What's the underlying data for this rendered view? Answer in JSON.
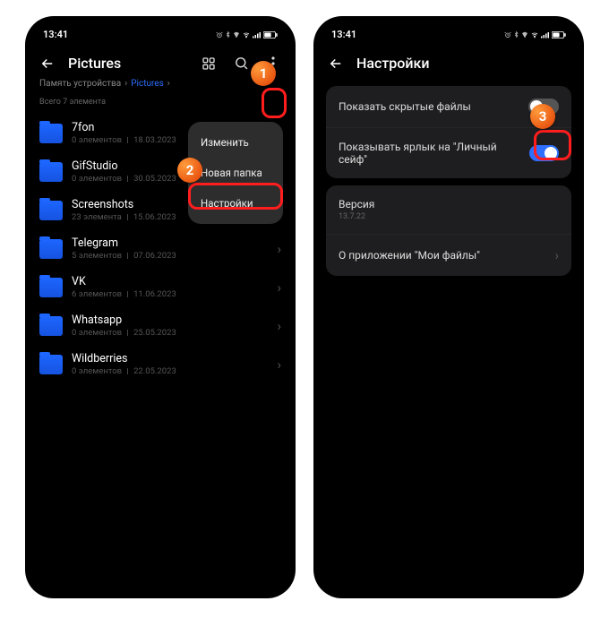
{
  "status": {
    "time": "13:41",
    "indicators": "⋯"
  },
  "left": {
    "title": "Pictures",
    "breadcrumb": {
      "root": "Память устройства",
      "active": "Pictures"
    },
    "count_label": "Всего 7 элемента",
    "menu": {
      "edit": "Изменить",
      "newfolder": "Новая папка",
      "settings": "Настройки"
    },
    "folders": [
      {
        "name": "7fon",
        "count": "0 элементов",
        "date": "18.03.2023"
      },
      {
        "name": "GifStudio",
        "count": "0 элементов",
        "date": "30.05.2023"
      },
      {
        "name": "Screenshots",
        "count": "23 элемента",
        "date": "15.06.2023"
      },
      {
        "name": "Telegram",
        "count": "5 элементов",
        "date": "07.06.2023"
      },
      {
        "name": "VK",
        "count": "6 элементов",
        "date": "11.06.2023"
      },
      {
        "name": "Whatsapp",
        "count": "0 элементов",
        "date": "25.05.2023"
      },
      {
        "name": "Wildberries",
        "count": "0 элементов",
        "date": "22.05.2023"
      }
    ]
  },
  "right": {
    "title": "Настройки",
    "rows": {
      "hidden": "Показать скрытые файлы",
      "vault": "Показывать ярлык на \"Личный сейф\"",
      "version_lbl": "Версия",
      "version_val": "13.7.22",
      "about": "О приложении \"Мои файлы\""
    }
  },
  "badges": {
    "b1": "1",
    "b2": "2",
    "b3": "3"
  }
}
